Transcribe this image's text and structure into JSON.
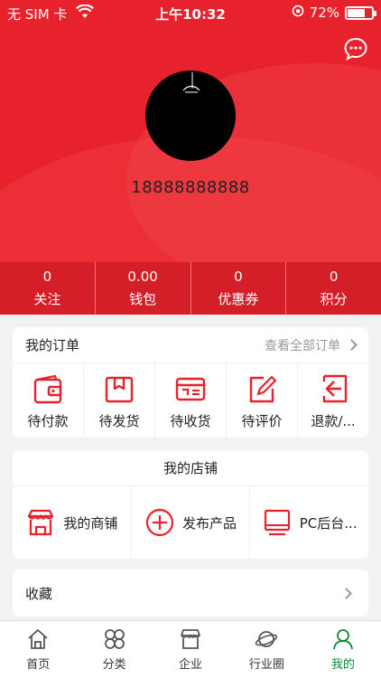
{
  "status_bar": {
    "carrier": "无 SIM 卡",
    "time": "上午10:32",
    "battery": "72%",
    "battery_level": 0.72
  },
  "header": {
    "phone": "18888888888",
    "bg_color": "#e8222c"
  },
  "stats": [
    {
      "value": "0",
      "label": "关注"
    },
    {
      "value": "0.00",
      "label": "钱包"
    },
    {
      "value": "0",
      "label": "优惠券"
    },
    {
      "value": "0",
      "label": "积分"
    }
  ],
  "orders": {
    "title": "我的订单",
    "view_all": "查看全部订单",
    "items": [
      {
        "label": "待付款",
        "icon": "wallet-icon"
      },
      {
        "label": "待发货",
        "icon": "box-icon"
      },
      {
        "label": "待收货",
        "icon": "card-icon"
      },
      {
        "label": "待评价",
        "icon": "pencil-icon"
      },
      {
        "label": "退款/...",
        "icon": "return-icon"
      }
    ]
  },
  "shop": {
    "title": "我的店铺",
    "items": [
      {
        "label": "我的商铺",
        "icon": "store-icon"
      },
      {
        "label": "发布产品",
        "icon": "plus-circle-icon"
      },
      {
        "label": "PC后台...",
        "icon": "monitor-icon"
      }
    ]
  },
  "favorites": {
    "label": "收藏"
  },
  "tabbar": [
    {
      "label": "首页",
      "icon": "home-icon"
    },
    {
      "label": "分类",
      "icon": "category-icon"
    },
    {
      "label": "企业",
      "icon": "shop-icon"
    },
    {
      "label": "行业圈",
      "icon": "planet-icon"
    },
    {
      "label": "我的",
      "icon": "user-icon",
      "active": true
    }
  ],
  "colors": {
    "accent": "#e8222c",
    "active_tab": "#0a8a34"
  }
}
